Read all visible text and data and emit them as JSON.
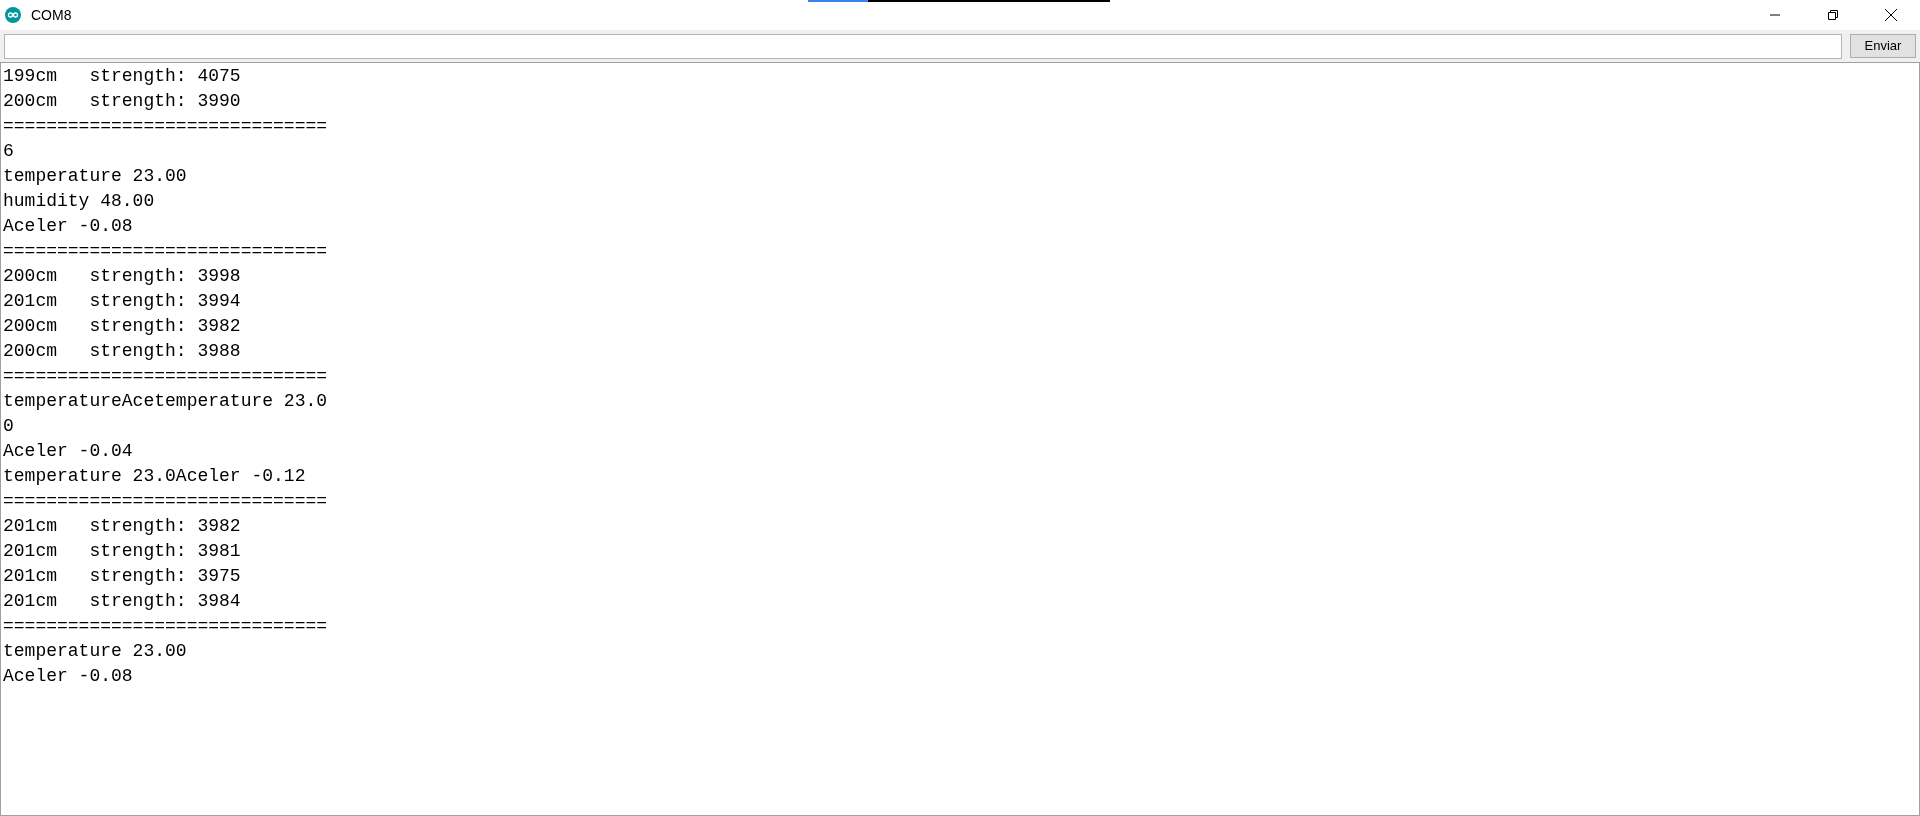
{
  "window": {
    "title": "COM8"
  },
  "send_bar": {
    "button": "Enviar"
  },
  "output": {
    "lines": [
      "199cm   strength: 4075",
      "200cm   strength: 3990",
      "==============================",
      "6",
      "temperature 23.00",
      "humidity 48.00",
      "Aceler -0.08",
      "==============================",
      "200cm   strength: 3998",
      "201cm   strength: 3994",
      "200cm   strength: 3982",
      "200cm   strength: 3988",
      "==============================",
      "temperatureAcetemperature 23.0",
      "0",
      "Aceler -0.04",
      "temperature 23.0Aceler -0.12",
      "==============================",
      "201cm   strength: 3982",
      "201cm   strength: 3981",
      "201cm   strength: 3975",
      "201cm   strength: 3984",
      "==============================",
      "temperature 23.00",
      "Aceler -0.08"
    ]
  }
}
